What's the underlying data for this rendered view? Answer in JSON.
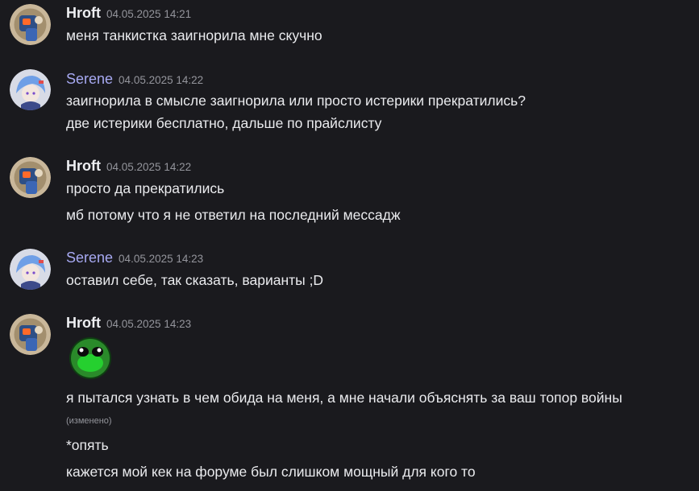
{
  "messages": [
    {
      "author": "Hroft",
      "timestamp": "04.05.2025 14:21",
      "lines": [
        "меня танкистка заигнорила мне скучно"
      ]
    },
    {
      "author": "Serene",
      "timestamp": "04.05.2025 14:22",
      "lines": [
        "заигнорила в смысле заигнорила или просто истерики прекратились?",
        "две истерики бесплатно, дальше по прайслисту"
      ]
    },
    {
      "author": "Hroft",
      "timestamp": "04.05.2025 14:22",
      "lines": [
        "просто да прекратились",
        "мб потому что я не ответил на последний мессадж"
      ]
    },
    {
      "author": "Serene",
      "timestamp": "04.05.2025 14:23",
      "lines": [
        "оставил себе, так сказать, варианты ;D"
      ]
    },
    {
      "author": "Hroft",
      "timestamp": "04.05.2025 14:23",
      "emoji": "green-frog-face-emoji",
      "lines": [
        "я пытался узнать в чем обида на меня, а мне начали объяснять за ваш топор войны",
        "*опять",
        "кажется мой кек на форуме был слишком мощный для кого то"
      ],
      "edited_label": "(изменено)"
    }
  ],
  "colors": {
    "background": "#1a1a1e",
    "hroft_name": "#eeeff2",
    "serene_name": "#a7a9f2",
    "timestamp": "#94959c",
    "text": "#eaebee",
    "emoji_green": "#2a8a2a"
  }
}
